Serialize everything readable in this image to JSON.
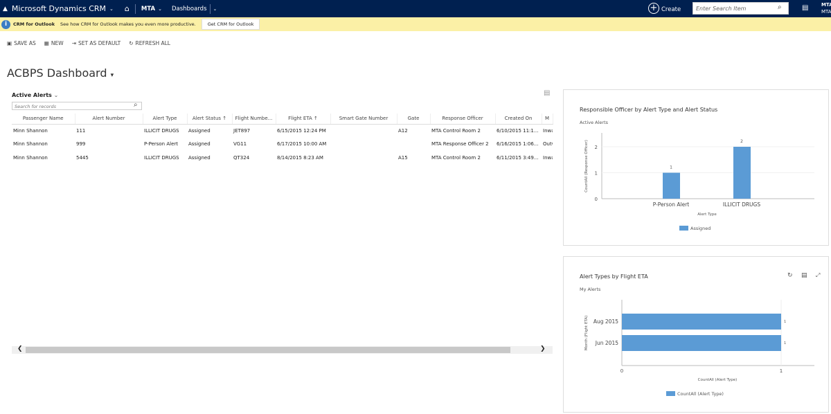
{
  "nav": {
    "brand": "Microsoft Dynamics CRM",
    "org": "MTA",
    "area": "Dashboards",
    "create": "Create",
    "search_placeholder": "Enter Search Item",
    "user1": "MTA",
    "user2": "MTA"
  },
  "notification": {
    "title": "CRM for Outlook",
    "text": "See how CRM for Outlook makes you even more productive.",
    "button": "Get CRM for Outlook"
  },
  "commands": [
    "SAVE AS",
    "NEW",
    "SET AS DEFAULT",
    "REFRESH ALL"
  ],
  "dashboard_title": "ACBPS Dashboard",
  "grid": {
    "view": "Active Alerts",
    "search_placeholder": "Search for records",
    "columns": [
      "Passenger Name",
      "Alert Number",
      "Alert Type",
      "Alert Status ↑",
      "Flight Numbe...",
      "Flight ETA ↑",
      "Smart Gate Number",
      "Gate",
      "Response Officer",
      "Created On",
      "M"
    ],
    "rows": [
      [
        "Minn Shannon",
        "111",
        "ILLICIT DRUGS",
        "Assigned",
        "JET897",
        "6/15/2015 12:24 PM",
        "",
        "A12",
        "MTA Control Room 2",
        "6/10/2015 11:1...",
        "Inwa"
      ],
      [
        "Minn Shannon",
        "999",
        "P-Person Alert",
        "Assigned",
        "VG11",
        "6/17/2015 10:00 AM",
        "",
        "",
        "MTA Response Officer 2",
        "6/16/2015 1:06...",
        "Outw"
      ],
      [
        "Minn Shannon",
        "5445",
        "ILLICIT DRUGS",
        "Assigned",
        "QT324",
        "8/14/2015 8:23 AM",
        "",
        "A15",
        "MTA Control Room 2",
        "6/11/2015 3:49...",
        "Inwa"
      ]
    ]
  },
  "chart_data": [
    {
      "type": "bar",
      "title": "Responsible Officer by Alert Type and Alert Status",
      "subtitle": "Active Alerts",
      "categories": [
        "P-Person Alert",
        "ILLICIT DRUGS"
      ],
      "series": [
        {
          "name": "Assigned",
          "values": [
            1,
            2
          ]
        }
      ],
      "xlabel": "Alert Type",
      "ylabel": "CountAll (Response Officer)",
      "ylim": [
        0,
        2.5
      ],
      "yticks": [
        "0",
        "1",
        "2"
      ],
      "legend": "bottom",
      "color": "#5b9bd5"
    },
    {
      "type": "bar",
      "orientation": "horizontal",
      "title": "Alert Types by Flight ETA",
      "subtitle": "My Alerts",
      "categories": [
        "Aug 2015",
        "Jun 2015"
      ],
      "series": [
        {
          "name": "CountAll (Alert Type)",
          "values": [
            1,
            1
          ]
        }
      ],
      "xlabel": "CountAll (Alert Type)",
      "ylabel": "Month (Flight ETA)",
      "xlim": [
        0,
        1.2
      ],
      "xticks": [
        "0",
        "1"
      ],
      "legend": "bottom",
      "color": "#5b9bd5"
    }
  ]
}
